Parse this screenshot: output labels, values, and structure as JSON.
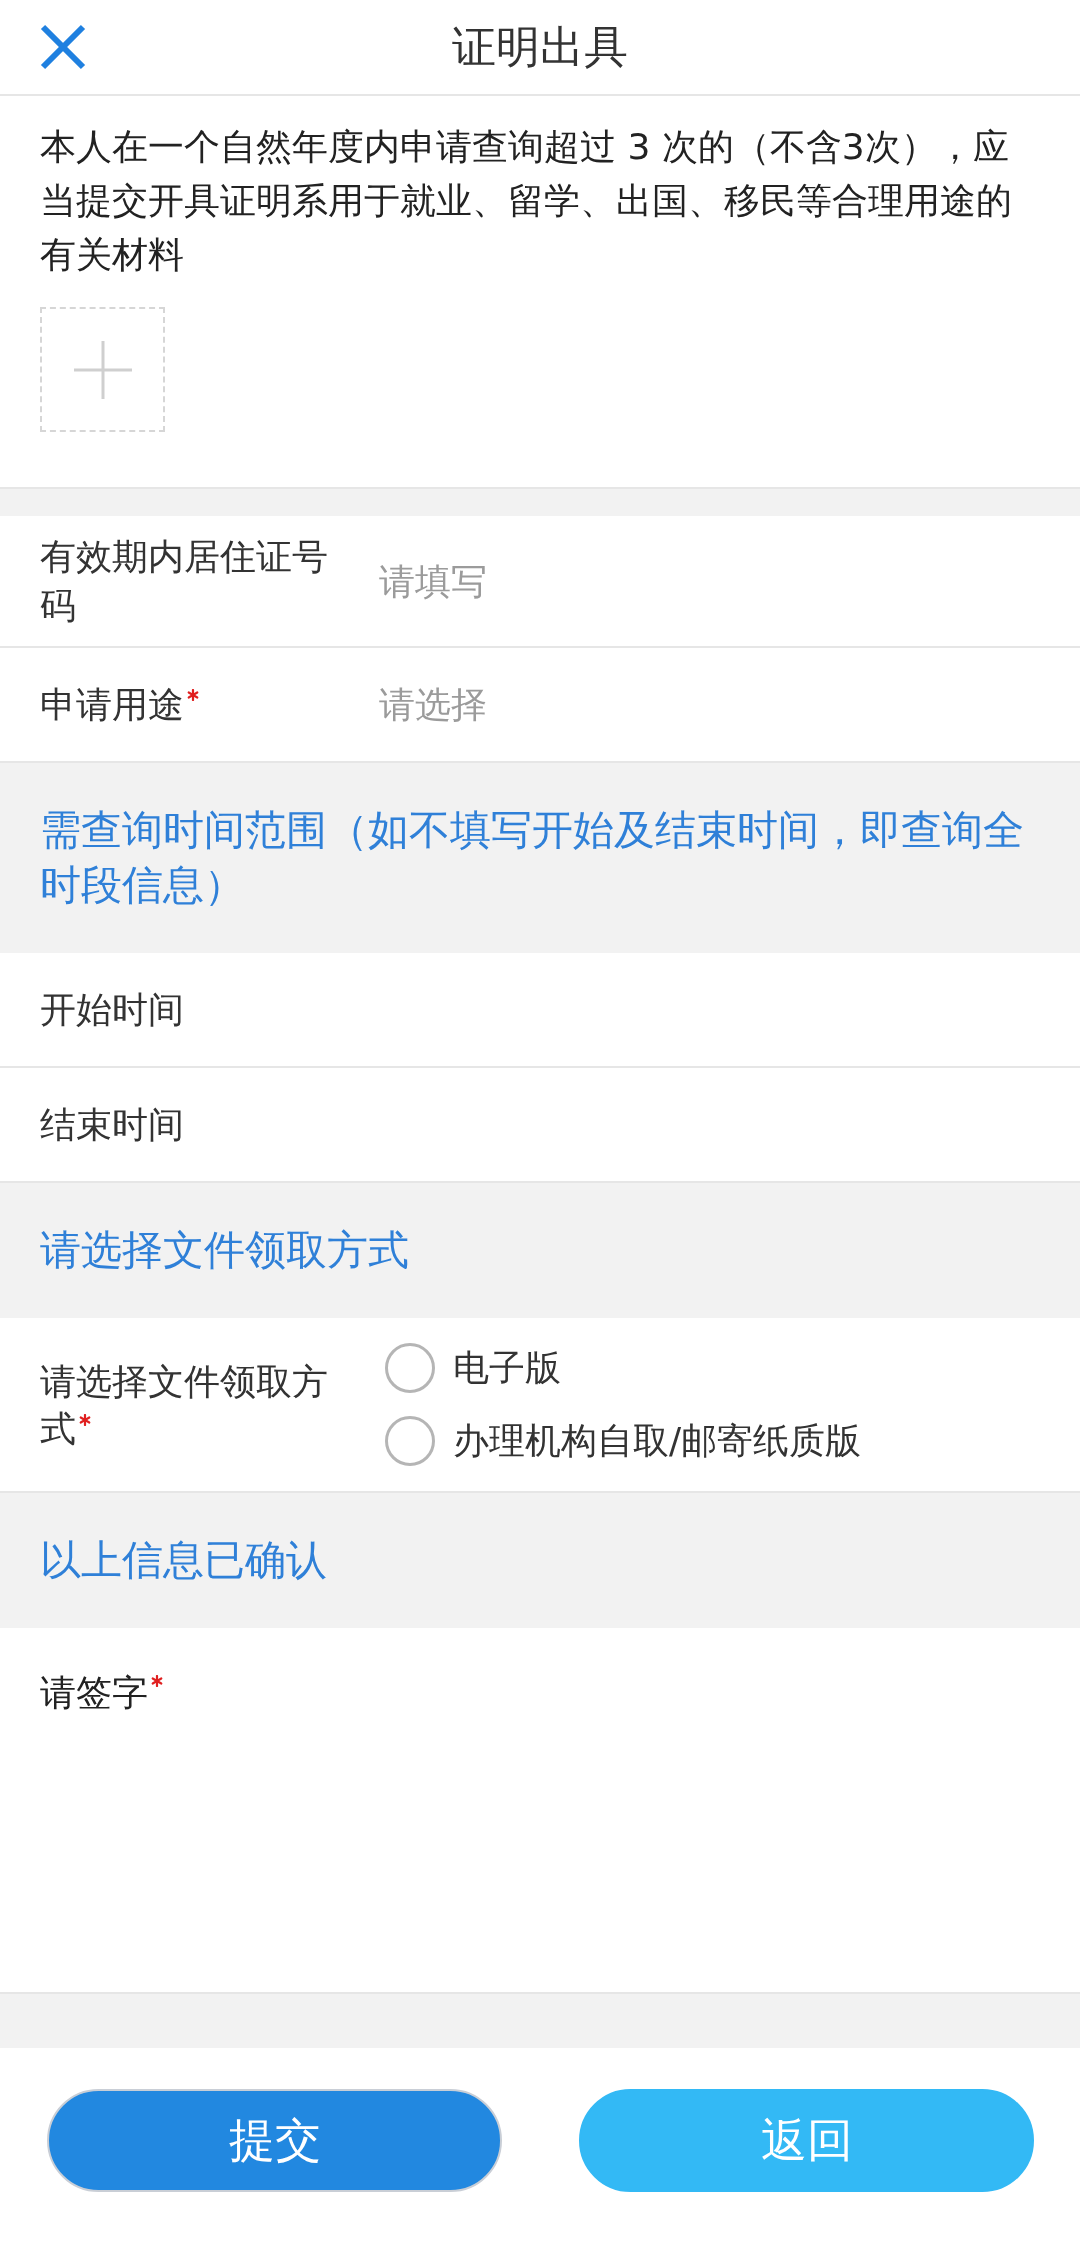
{
  "header": {
    "title": "证明出具"
  },
  "attachment": {
    "description": "本人在一个自然年度内申请查询超过 3 次的（不含3次），应当提交开具证明系用于就业、留学、出国、移民等合理用途的有关材料"
  },
  "sections": [
    {
      "rows": [
        {
          "kind": "input",
          "label": "有效期内居住证号码",
          "required": false,
          "placeholder": "请填写"
        },
        {
          "kind": "select",
          "label": "申请用途",
          "required": true,
          "placeholder": "请选择"
        }
      ]
    },
    {
      "heading": "需查询时间范围（如不填写开始及结束时间，即查询全时段信息）",
      "rows": [
        {
          "kind": "date",
          "label": "开始时间",
          "required": false
        },
        {
          "kind": "date",
          "label": "结束时间",
          "required": false
        }
      ]
    },
    {
      "heading": "请选择文件领取方式",
      "rows": [
        {
          "kind": "radio",
          "label": "请选择文件领取方式",
          "required": true,
          "options": [
            {
              "label": "电子版",
              "selected": false
            },
            {
              "label": "办理机构自取/邮寄纸质版",
              "selected": false
            }
          ]
        }
      ]
    },
    {
      "heading": "以上信息已确认",
      "rows": [
        {
          "kind": "signature",
          "label": "请签字",
          "required": true
        }
      ]
    }
  ],
  "buttons": [
    {
      "label": "提交",
      "kind": "primary"
    },
    {
      "label": "返回",
      "kind": "secondary"
    }
  ]
}
